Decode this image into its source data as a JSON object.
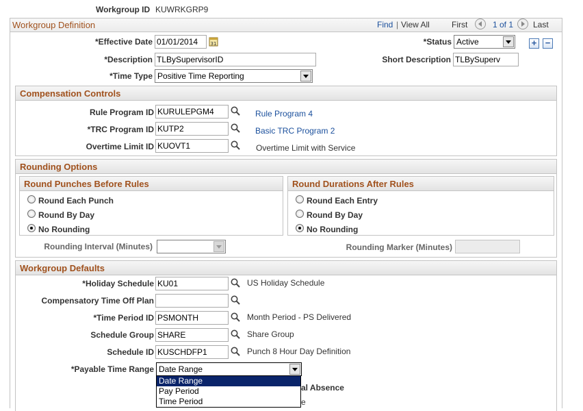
{
  "header": {
    "workgroup_id_label": "Workgroup ID",
    "workgroup_id_value": "KUWRKGRP9"
  },
  "definition": {
    "title": "Workgroup Definition",
    "nav": {
      "find": "Find",
      "separator": "|",
      "view_all": "View All",
      "first": "First",
      "page_info": "1 of 1",
      "last": "Last"
    },
    "effective_date_label": "*Effective Date",
    "effective_date_value": "01/01/2014",
    "status_label": "*Status",
    "status_value": "Active",
    "description_label": "*Description",
    "description_value": "TLBySupervisorID",
    "short_description_label": "Short Description",
    "short_description_value": "TLBySuperv",
    "time_type_label": "*Time Type",
    "time_type_value": "Positive Time Reporting",
    "add_label": "+",
    "remove_label": "−"
  },
  "compensation": {
    "title": "Compensation Controls",
    "rule_program_label": "Rule Program ID",
    "rule_program_value": "KURULEPGM4",
    "rule_program_desc": "Rule Program 4",
    "trc_program_label": "*TRC Program ID",
    "trc_program_value": "KUTP2",
    "trc_program_desc": "Basic TRC Program 2",
    "overtime_label": "Overtime Limit ID",
    "overtime_value": "KUOVT1",
    "overtime_desc": "Overtime Limit with Service"
  },
  "rounding": {
    "title": "Rounding Options",
    "punches": {
      "title": "Round Punches Before Rules",
      "options": [
        "Round Each Punch",
        "Round By Day",
        "No Rounding"
      ],
      "selected": "No Rounding"
    },
    "durations": {
      "title": "Round Durations After Rules",
      "options": [
        "Round Each Entry",
        "Round By Day",
        "No Rounding"
      ],
      "selected": "No Rounding"
    },
    "interval_label": "Rounding Interval (Minutes)",
    "interval_value": "",
    "marker_label": "Rounding Marker (Minutes)",
    "marker_value": ""
  },
  "defaults": {
    "title": "Workgroup Defaults",
    "holiday_label": "*Holiday Schedule",
    "holiday_value": "KU01",
    "holiday_desc": "US Holiday Schedule",
    "comp_time_label": "Compensatory Time Off Plan",
    "comp_time_value": "",
    "time_period_label": "*Time Period ID",
    "time_period_value": "PSMONTH",
    "time_period_desc": "Month Period - PS Delivered",
    "schedule_group_label": "Schedule Group",
    "schedule_group_value": "SHARE",
    "schedule_group_desc": "Share Group",
    "schedule_id_label": "Schedule ID",
    "schedule_id_value": "KUSCHDFP1",
    "schedule_id_desc": "Punch 8 Hour Day Definition",
    "payable_time_label": "*Payable Time Range",
    "payable_time_value": "Date Range",
    "payable_time_options": [
      "Date Range",
      "Pay Period",
      "Time Period"
    ],
    "partial_absence_fragment": "al Absence",
    "hidden_fragment": "e"
  },
  "colors": {
    "section_title": "#a0511d",
    "link": "#1a4f9c",
    "dropdown_selected": "#0a246a"
  }
}
